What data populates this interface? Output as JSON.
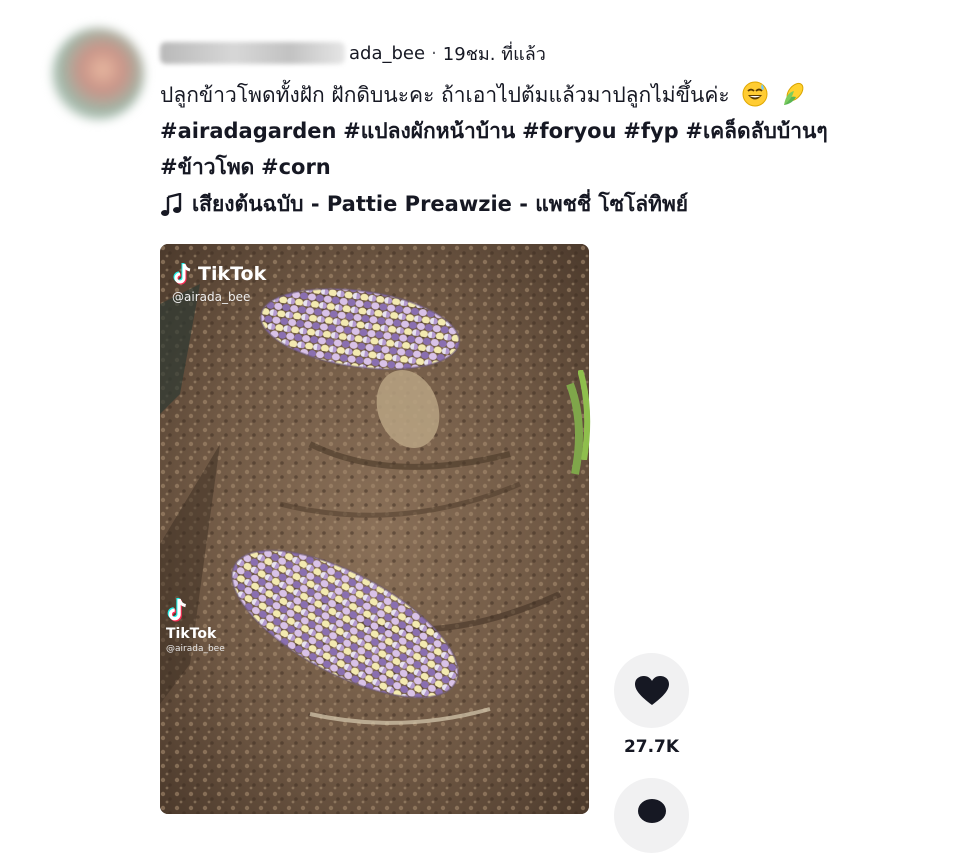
{
  "post": {
    "username_suffix": "ada_bee",
    "separator": "·",
    "time_ago": "19ชม. ที่แล้ว",
    "caption_text": "ปลูกข้าวโพดทั้งฝัก ฝักดิบนะคะ ถ้าเอาไปต้มแล้วมาปลูกไม่ขึ้นค่ะ",
    "emojis": [
      "grinning-sweat-emoji",
      "corn-emoji"
    ],
    "hashtags": [
      "#airadagarden",
      "#แปลงผักหน้าบ้าน",
      "#foryou",
      "#fyp",
      "#เคล็ดลับบ้านๆ",
      "#ข้าวโพด",
      "#corn"
    ],
    "music": "เสียงต้นฉบับ - Pattie Preawzie - แพชชี่ โซโล่ทิพย์"
  },
  "video": {
    "watermark_brand": "TikTok",
    "watermark_user": "@airada_bee",
    "watermark_user_small": "@airada_bee"
  },
  "actions": {
    "like_count": "27.7K"
  },
  "colors": {
    "text": "#161823",
    "button_bg": "#f1f1f2",
    "soil": "#6b5645"
  }
}
